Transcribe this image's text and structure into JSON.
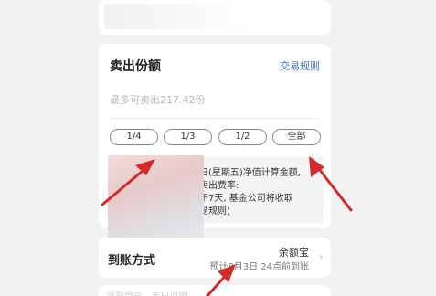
{
  "sell_section": {
    "title": "卖出份额",
    "rules_link": "交易规则",
    "max_hint": "最多可卖出217.42份",
    "quick_options": [
      "1/4",
      "1/3",
      "1/2",
      "全部"
    ],
    "notice_lines": [
      "日(星期五)净值计算金额,",
      "卖出费率:",
      "于7天, 基金公司将收取",
      "易规则)"
    ]
  },
  "arrival_section": {
    "title": "到账方式",
    "method": "余额宝",
    "estimate": "预计8月3日 24点前到账",
    "chevron_icon": "chevron-right-icon"
  },
  "bottom_section": {
    "text": "温馨提示 · 卖出说明"
  },
  "annotations": {
    "arrow_color": "#d42a2a"
  },
  "colors": {
    "accent": "#3a6fd4",
    "background": "#f2f2f4"
  }
}
